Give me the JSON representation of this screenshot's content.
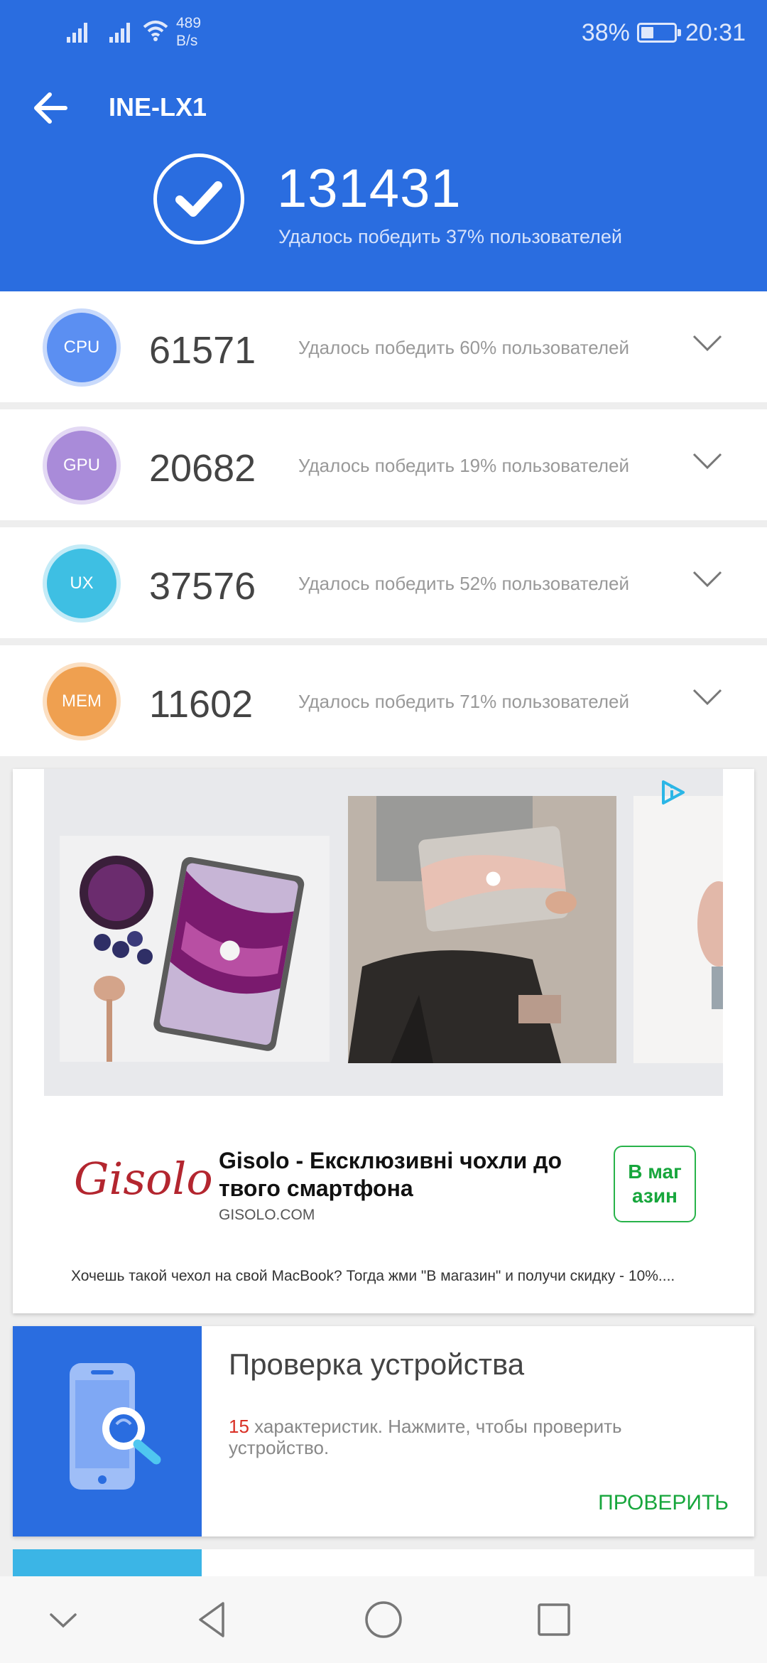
{
  "status_bar": {
    "net_speed_value": "489",
    "net_speed_unit": "B/s",
    "battery": "38%",
    "time": "20:31"
  },
  "header": {
    "title": "INE-LX1",
    "total_score": "131431",
    "total_subtitle": "Удалось победить 37% пользователей"
  },
  "scores": [
    {
      "label": "CPU",
      "score": "61571",
      "subtitle": "Удалось победить 60% пользователей",
      "color": "#5b8ff2",
      "ring": "#c9dafb"
    },
    {
      "label": "GPU",
      "score": "20682",
      "subtitle": "Удалось победить 19% пользователей",
      "color": "#a98bd9",
      "ring": "#e3d9f4"
    },
    {
      "label": "UX",
      "score": "37576",
      "subtitle": "Удалось победить 52% пользователей",
      "color": "#3ebfe3",
      "ring": "#c4ebf7"
    },
    {
      "label": "MEM",
      "score": "11602",
      "subtitle": "Удалось победить 71% пользователей",
      "color": "#efa050",
      "ring": "#fbdfc2"
    }
  ],
  "ad": {
    "logo": "Gisolo",
    "title": "Gisolo - Ексклюзивні чохли до твого смартфона",
    "domain": "GISOLO.COM",
    "cta": "В магазин",
    "description": "Хочешь такой чехол на свой MacBook? Тогда жми \"В магазин\" и получи скидку - 10%...."
  },
  "device_check": {
    "title": "Проверка устройства",
    "count": "15",
    "description": " характеристик. Нажмите, чтобы проверить устройство.",
    "button": "ПРОВЕРИТЬ"
  },
  "colors": {
    "primary": "#2a6de0",
    "green": "#17a63c"
  }
}
